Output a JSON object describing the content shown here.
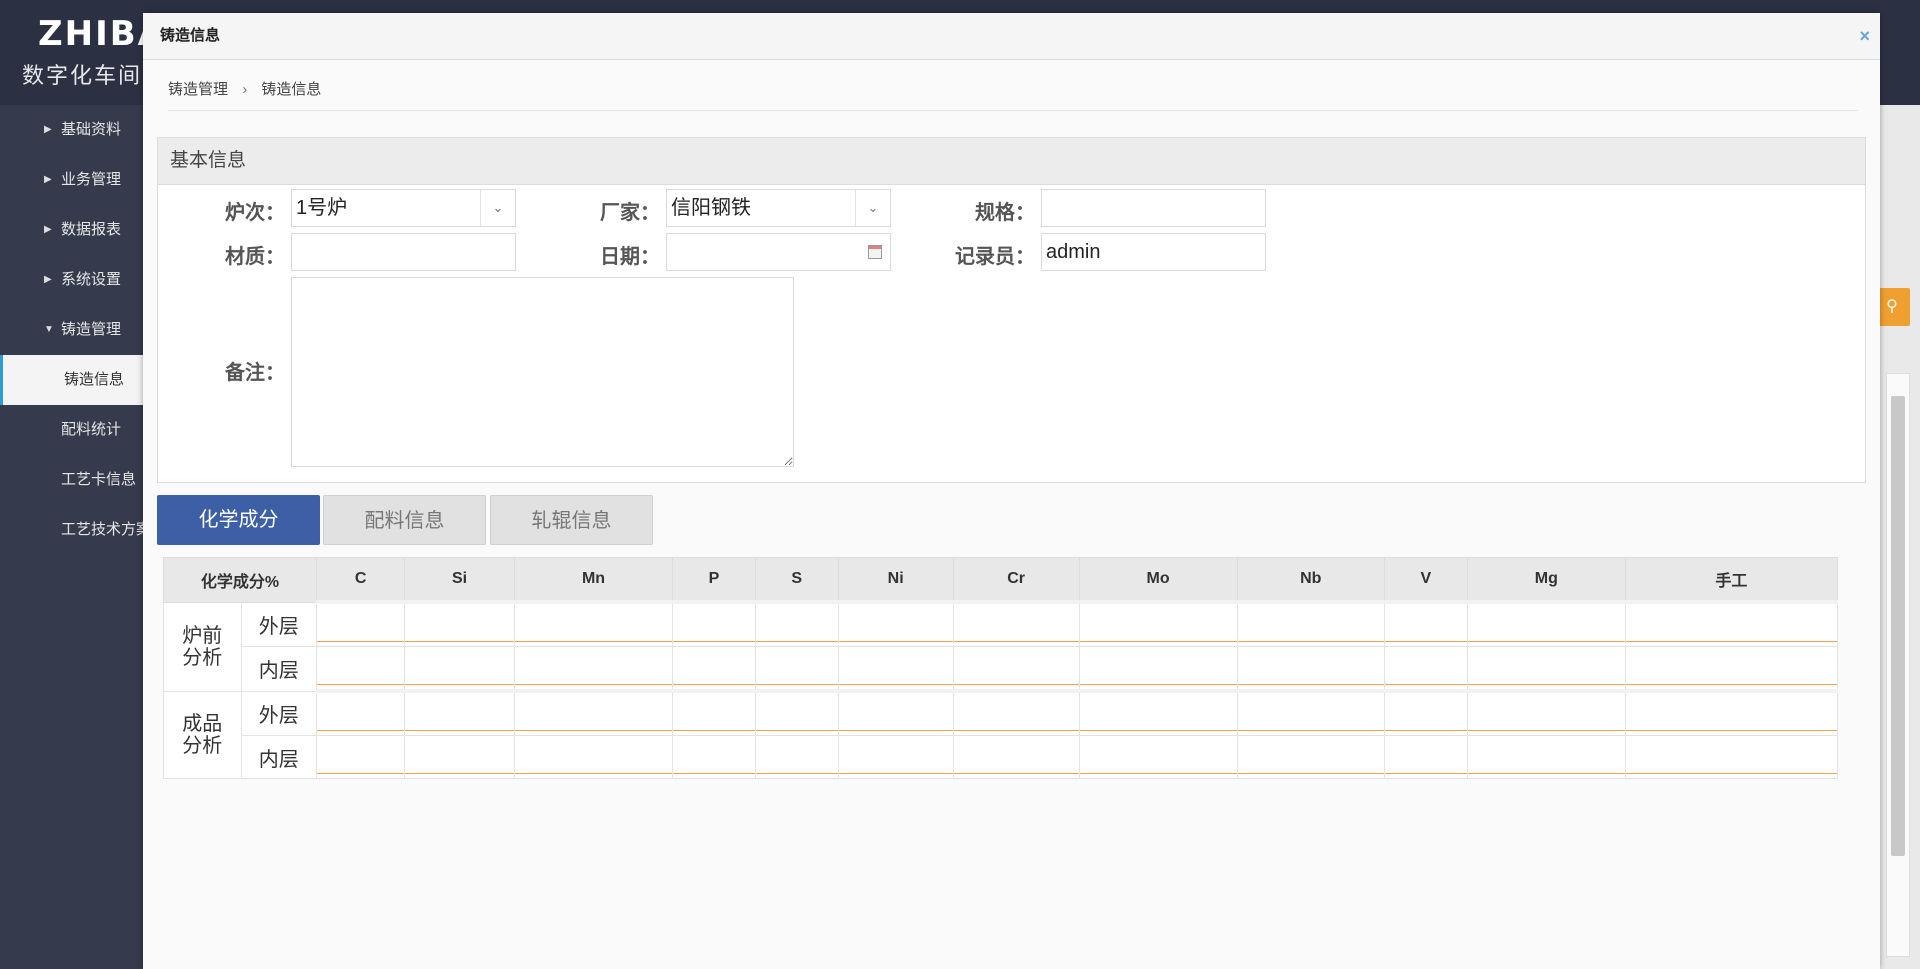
{
  "app": {
    "logo": "ZHIBA",
    "subtitle": "数字化车间"
  },
  "sidebar": {
    "items": [
      {
        "label": "基础资料",
        "caret": "right"
      },
      {
        "label": "业务管理",
        "caret": "right"
      },
      {
        "label": "数据报表",
        "caret": "right"
      },
      {
        "label": "系统设置",
        "caret": "right"
      },
      {
        "label": "铸造管理",
        "caret": "down"
      },
      {
        "label": "铸造信息"
      },
      {
        "label": "配料统计"
      },
      {
        "label": "工艺卡信息"
      },
      {
        "label": "工艺技术方案"
      }
    ]
  },
  "modal": {
    "title": "铸造信息",
    "close_glyph": "×",
    "breadcrumb": [
      "铸造管理",
      "铸造信息"
    ],
    "breadcrumb_sep": "›"
  },
  "form": {
    "panel_title": "基本信息",
    "furnace": {
      "label": "炉次：",
      "value": "1号炉"
    },
    "vendor": {
      "label": "厂家：",
      "value": "信阳钢铁"
    },
    "spec": {
      "label": "规格：",
      "value": ""
    },
    "material": {
      "label": "材质：",
      "value": ""
    },
    "date": {
      "label": "日期：",
      "value": ""
    },
    "recorder": {
      "label": "记录员：",
      "value": "admin"
    },
    "remark": {
      "label": "备注：",
      "value": ""
    }
  },
  "tabs": [
    "化学成分",
    "配料信息",
    "轧辊信息"
  ],
  "chem_table": {
    "header_first": "化学成分%",
    "elements": [
      "C",
      "Si",
      "Mn",
      "P",
      "S",
      "Ni",
      "Cr",
      "Mo",
      "Nb",
      "V",
      "Mg",
      "手工"
    ],
    "groups": [
      {
        "name_lines": [
          "炉前",
          "分析"
        ],
        "rows": [
          "外层",
          "内层"
        ]
      },
      {
        "name_lines": [
          "成品",
          "分析"
        ],
        "rows": [
          "外层",
          "内层"
        ]
      }
    ]
  },
  "colors": {
    "topbar": "#2b3043",
    "sidebar": "#353a4d",
    "active_tab": "#3c5fa6",
    "input_underline": "#f0a050",
    "accent": "#2f9bd5"
  }
}
